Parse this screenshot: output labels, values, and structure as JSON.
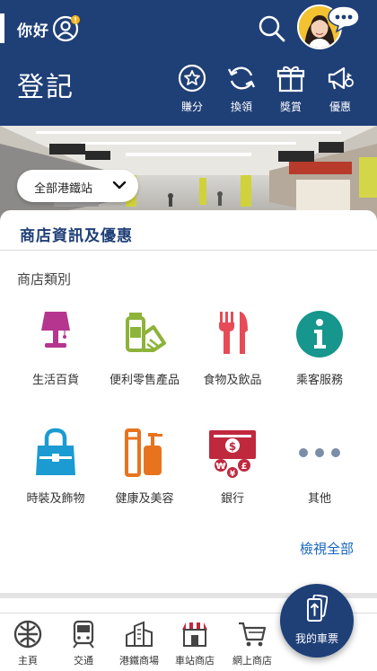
{
  "header": {
    "greeting": "你好",
    "page_title": "登記",
    "actions": [
      {
        "label": "賺分",
        "icon": "star-coin-icon"
      },
      {
        "label": "換領",
        "icon": "refresh-icon"
      },
      {
        "label": "獎賞",
        "icon": "gift-icon"
      },
      {
        "label": "優惠",
        "icon": "megaphone-icon"
      }
    ]
  },
  "banner": {
    "station_select": "全部港鐵站"
  },
  "content": {
    "section_title": "商店資訊及優惠",
    "category_heading": "商店類別",
    "categories": [
      {
        "label": "生活百貨",
        "icon": "lamp-icon",
        "color": "#b5358f"
      },
      {
        "label": "便利零售產品",
        "icon": "convenience-goods-icon",
        "color": "#8db33a"
      },
      {
        "label": "食物及飲品",
        "icon": "fork-knife-icon",
        "color": "#e64b57"
      },
      {
        "label": "乘客服務",
        "icon": "info-icon",
        "color": "#16968c"
      },
      {
        "label": "時裝及飾物",
        "icon": "handbag-icon",
        "color": "#1b9bd1"
      },
      {
        "label": "健康及美容",
        "icon": "cosmetics-icon",
        "color": "#e8731e"
      },
      {
        "label": "銀行",
        "icon": "bank-money-icon",
        "color": "#c0283e"
      },
      {
        "label": "其他",
        "icon": "more-dots-icon",
        "color": "#7a8ea8"
      }
    ],
    "view_all": "檢視全部"
  },
  "bottom_nav": {
    "items": [
      {
        "label": "主頁",
        "icon": "mtr-logo-icon"
      },
      {
        "label": "交通",
        "icon": "train-icon"
      },
      {
        "label": "港鐵商場",
        "icon": "mall-buildings-icon"
      },
      {
        "label": "車站商店",
        "icon": "shop-icon"
      },
      {
        "label": "網上商店",
        "icon": "cart-icon"
      }
    ],
    "ticket_label": "我的車票"
  }
}
